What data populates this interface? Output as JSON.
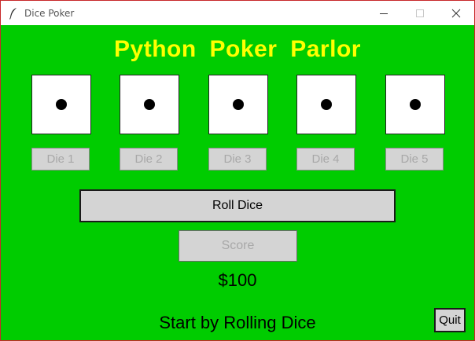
{
  "window": {
    "title": "Dice Poker",
    "icon": "feather-icon",
    "border_color": "#c8282a"
  },
  "app": {
    "heading": "Python  Poker  Parlor",
    "background_color": "#00cc00",
    "heading_color": "#ffff00"
  },
  "dice": [
    {
      "label": "Die 1",
      "pips": 1
    },
    {
      "label": "Die 2",
      "pips": 1
    },
    {
      "label": "Die 3",
      "pips": 1
    },
    {
      "label": "Die 4",
      "pips": 1
    },
    {
      "label": "Die 5",
      "pips": 1
    }
  ],
  "controls": {
    "roll_label": "Roll Dice",
    "score_label": "Score",
    "quit_label": "Quit"
  },
  "money": "$100",
  "status": "Start by Rolling Dice"
}
